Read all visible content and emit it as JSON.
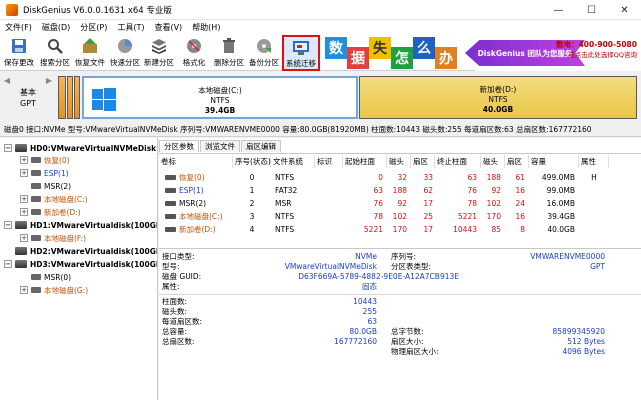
{
  "window": {
    "title": "DiskGenius V6.0.0.1631 x64 专业版",
    "minimize": "—",
    "maximize": "☐",
    "close": "✕"
  },
  "menu": [
    "文件(F)",
    "磁盘(D)",
    "分区(P)",
    "工具(T)",
    "查看(V)",
    "帮助(H)"
  ],
  "toolbar": [
    {
      "label": "保存更改",
      "icon": "save-icon"
    },
    {
      "label": "搜索分区",
      "icon": "search-icon"
    },
    {
      "label": "恢复文件",
      "icon": "recover-icon"
    },
    {
      "label": "快速分区",
      "icon": "quick-partition-icon"
    },
    {
      "label": "新建分区",
      "icon": "new-partition-icon"
    },
    {
      "label": "格式化",
      "icon": "format-icon"
    },
    {
      "label": "删除分区",
      "icon": "delete-icon"
    },
    {
      "label": "备份分区",
      "icon": "backup-icon"
    },
    {
      "label": "系统迁移",
      "icon": "migrate-icon"
    }
  ],
  "banner": {
    "tiles": [
      "数",
      "据",
      "失",
      "怎",
      "么",
      "办"
    ],
    "arrow_text": "DiskGenius 团队为您服务",
    "hotline": "数电：400-900-5080",
    "hotline_sub": "或点击此处选择QQ咨询"
  },
  "diskmap": {
    "basic_label": "基本",
    "type_label": "GPT",
    "partition_c": {
      "name": "本地磁盘(C:)",
      "fs": "NTFS",
      "size": "39.4GB"
    },
    "partition_d": {
      "name": "新加卷(D:)",
      "fs": "NTFS",
      "size": "40.0GB"
    }
  },
  "infoline": "磁盘0 接口:NVMe  型号:VMwareVirtualNVMeDisk  序列号:VMWARENVME0000  容量:80.0GB(81920MB)  柱面数:10443  磁头数:255  每道扇区数:63  总扇区数:167772160",
  "tree": {
    "disks": [
      {
        "label": "HD0:VMwareVirtualNVMeDisk",
        "children": [
          "恢复(0)",
          "ESP(1)",
          "MSR(2)",
          "本地磁盘(C:)",
          "新加卷(D:)"
        ]
      },
      {
        "label": "HD1:VMwareVirtualdisk(100GB",
        "children": [
          "本地磁盘(F:)"
        ]
      },
      {
        "label": "HD2:VMwareVirtualdisk(100GB",
        "children": []
      },
      {
        "label": "HD3:VMwareVirtualdisk(100GB",
        "children": [
          "MSR(0)",
          "本地磁盘(G:)"
        ]
      }
    ]
  },
  "tabs": [
    "分区参数",
    "浏览文件",
    "扇区编辑"
  ],
  "partition_table": {
    "headers": [
      "卷标",
      "序号(状态)",
      "文件系统",
      "标识",
      "起始柱面",
      "磁头",
      "扇区",
      "终止柱面",
      "磁头",
      "扇区",
      "容量",
      "属性"
    ],
    "rows": [
      {
        "label": "恢复(0)",
        "seq": "0",
        "fs": "NTFS",
        "flag": "",
        "sc": "0",
        "sh": "32",
        "ss": "33",
        "ec": "63",
        "eh": "188",
        "es": "61",
        "size": "499.0MB",
        "attr": "H"
      },
      {
        "label": "ESP(1)",
        "seq": "1",
        "fs": "FAT32",
        "flag": "",
        "sc": "63",
        "sh": "188",
        "ss": "62",
        "ec": "76",
        "eh": "92",
        "es": "16",
        "size": "99.0MB",
        "attr": ""
      },
      {
        "label": "MSR(2)",
        "seq": "2",
        "fs": "MSR",
        "flag": "",
        "sc": "76",
        "sh": "92",
        "ss": "17",
        "ec": "78",
        "eh": "102",
        "es": "24",
        "size": "16.0MB",
        "attr": ""
      },
      {
        "label": "本地磁盘(C:)",
        "seq": "3",
        "fs": "NTFS",
        "flag": "",
        "sc": "78",
        "sh": "102",
        "ss": "25",
        "ec": "5221",
        "eh": "170",
        "es": "16",
        "size": "39.4GB",
        "attr": ""
      },
      {
        "label": "新加卷(D:)",
        "seq": "4",
        "fs": "NTFS",
        "flag": "",
        "sc": "5221",
        "sh": "170",
        "ss": "17",
        "ec": "10443",
        "eh": "85",
        "es": "8",
        "size": "40.0GB",
        "attr": ""
      }
    ]
  },
  "details": {
    "interface_label": "接口类型:",
    "interface_value": "NVMe",
    "serial_label": "序列号:",
    "serial_value": "VMWARENVME0000",
    "model_label": "型号:",
    "model_value": "VMwareVirtualNVMeDisk",
    "parttype_label": "分区表类型:",
    "parttype_value": "GPT",
    "guid_label": "磁盘 GUID:",
    "guid_value": "D63F669A-5789-4882-9E0E-A12A7CB913E",
    "attr_label": "属性:",
    "attr_value": "固态",
    "cyl_label": "柱面数:",
    "cyl_value": "10443",
    "heads_label": "磁头数:",
    "heads_value": "255",
    "spt_label": "每道扇区数:",
    "spt_value": "63",
    "cap_label": "总容量:",
    "cap_value": "80.0GB",
    "totalbytes_label": "总字节数:",
    "totalbytes_value": "85899345920",
    "totalsec_label": "总扇区数:",
    "totalsec_value": "167772160",
    "secsize_label": "扇区大小:",
    "secsize_value": "512 Bytes",
    "physsec_label": "物理扇区大小:",
    "physsec_value": "4096 Bytes"
  }
}
